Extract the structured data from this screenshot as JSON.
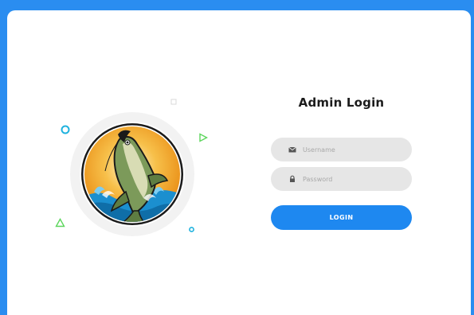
{
  "login": {
    "title": "Admin Login",
    "username_placeholder": "Username",
    "password_placeholder": "Password",
    "button_label": "LOGIN"
  },
  "icons": {
    "username": "envelope-icon",
    "password": "lock-icon",
    "logo": "jumping-fish-logo"
  },
  "colors": {
    "frame": "#2a8df0",
    "accent": "#1e88f0",
    "field_bg": "#e6e6e6",
    "deco_cyan": "#1fb2de",
    "deco_green": "#5cd65c"
  }
}
